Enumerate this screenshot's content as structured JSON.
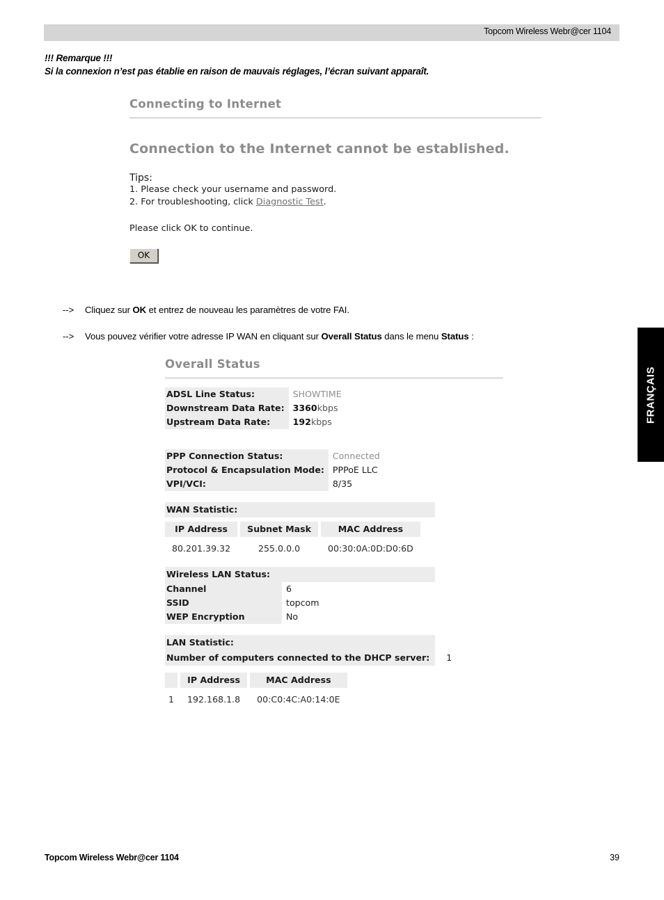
{
  "header": {
    "running_head": "Topcom Wireless Webr@cer 1104"
  },
  "remark": {
    "title": "!!! Remarque  !!!",
    "text": "Si la connexion n’est pas établie en raison de mauvais réglages, l’écran suivant apparaît."
  },
  "connecting_screen": {
    "title": "Connecting to Internet",
    "headline": "Connection to the Internet cannot be established.",
    "tips_label": "Tips:",
    "tip1": "1. Please check your username and password.",
    "tip2_prefix": "2. For troubleshooting, click ",
    "tip2_link": "Diagnostic Test",
    "tip2_suffix": ".",
    "please_click": "Please click OK to continue.",
    "ok_button": "OK"
  },
  "instructions": {
    "line1": {
      "arrow": "-->",
      "part1": "Cliquez sur ",
      "bold1": "OK",
      "part2": " et entrez de nouveau les paramètres de votre FAI."
    },
    "line2": {
      "arrow": "-->",
      "part1": "Vous pouvez vérifier votre adresse IP WAN en cliquant sur ",
      "bold1": "Overall Status",
      "part2": " dans le menu ",
      "bold2": "Status",
      "part3": " :"
    }
  },
  "overall_status": {
    "title": "Overall Status",
    "adsl": [
      {
        "key": "ADSL Line Status:",
        "value": "SHOWTIME",
        "muted": true
      },
      {
        "key": "Downstream Data Rate:",
        "num": "3360",
        "unit": "kbps"
      },
      {
        "key": "Upstream Data Rate:",
        "num": "192",
        "unit": "kbps"
      }
    ],
    "ppp": [
      {
        "key": "PPP Connection Status:",
        "value": "Connected",
        "muted": true
      },
      {
        "key": "Protocol & Encapsulation Mode:",
        "value": "PPPoE LLC"
      },
      {
        "key": "VPI/VCI:",
        "value": "8/35"
      }
    ],
    "wan_statistic": {
      "section_label": "WAN Statistic:",
      "columns": [
        "IP Address",
        "Subnet Mask",
        "MAC Address"
      ],
      "rows": [
        [
          "80.201.39.32",
          "255.0.0.0",
          "00:30:0A:0D:D0:6D"
        ]
      ]
    },
    "wireless_lan": {
      "section_label": "Wireless LAN Status:",
      "rows": [
        {
          "key": "Channel",
          "value": "6"
        },
        {
          "key": "SSID",
          "value": "topcom"
        },
        {
          "key": "WEP Encryption",
          "value": "No"
        }
      ]
    },
    "lan_statistic": {
      "section_label": "LAN Statistic:",
      "dhcp_label": "Number of computers connected to the DHCP server:",
      "dhcp_count": "1",
      "columns": [
        "",
        "IP Address",
        "MAC Address"
      ],
      "rows": [
        [
          "1",
          "192.168.1.8",
          "00:C0:4C:A0:14:0E"
        ]
      ]
    }
  },
  "language_tab": {
    "label": "FRANÇAIS"
  },
  "footer": {
    "left": "Topcom Wireless Webr@cer 1104",
    "page_number": "39"
  },
  "colors": {
    "header_bar": "#d5d5d5",
    "label_bg": "#ececec",
    "screen_title": "#8c8c8c",
    "tab_bg": "#000000"
  }
}
